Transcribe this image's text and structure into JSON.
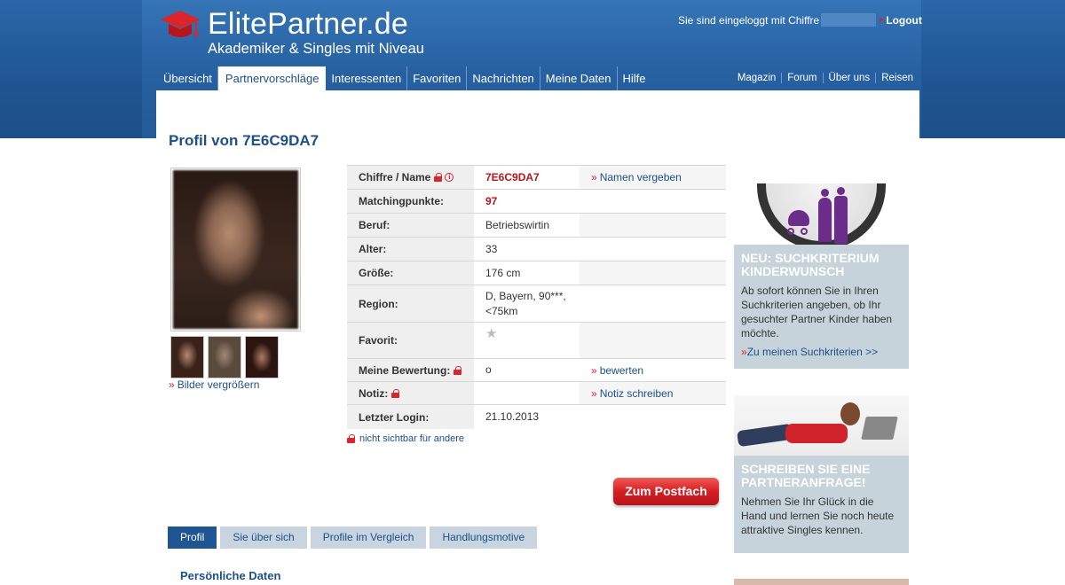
{
  "brand": {
    "logo_text": "ElitePartner.de",
    "tagline": "Akademiker & Singles mit Niveau"
  },
  "login": {
    "text": "Sie sind eingeloggt mit Chiffre",
    "logout": "Logout"
  },
  "main_nav": [
    "Übersicht",
    "Partnervorschläge",
    "Interessenten",
    "Favoriten",
    "Nachrichten",
    "Meine Daten",
    "Hilfe"
  ],
  "main_nav_active": "Partnervorschläge",
  "meta_nav": [
    "Magazin",
    "Forum",
    "Über uns",
    "Reisen"
  ],
  "profile": {
    "title": "Profil von 7E6C9DA7",
    "enlarge_link": "Bilder vergrößern",
    "rows": [
      {
        "label": "Chiffre / Name",
        "value": "7E6C9DA7",
        "action": "Namen vergeben"
      },
      {
        "label": "Matchingpunkte:",
        "value": "97",
        "action": ""
      },
      {
        "label": "Beruf:",
        "value": "Betriebswirtin",
        "action": ""
      },
      {
        "label": "Alter:",
        "value": "33",
        "action": ""
      },
      {
        "label": "Größe:",
        "value": "176 cm",
        "action": ""
      },
      {
        "label": "Region:",
        "value": "D, Bayern, 90***, <75km",
        "action": ""
      },
      {
        "label": "Favorit:",
        "value": "★",
        "action": ""
      },
      {
        "label": "Meine Bewertung:",
        "value": "o",
        "action": "bewerten"
      },
      {
        "label": "Notiz:",
        "value": "",
        "action": "Notiz schreiben"
      },
      {
        "label": "Letzter Login:",
        "value": "21.10.2013",
        "action": ""
      }
    ],
    "legend_note": "nicht sichtbar für andere",
    "postfach_button": "Zum Postfach"
  },
  "tabs": [
    "Profil",
    "Sie über sich",
    "Profile im Vergleich",
    "Handlungsmotive"
  ],
  "active_tab": "Profil",
  "section_title": "Persönliche Daten",
  "promos": [
    {
      "headline": "NEU: SUCHKRITERIUM KINDERWUNSCH",
      "text": "Ab sofort können Sie in Ihren Suchkriterien angeben, ob Ihr gesuchter Partner Kinder haben möchte.",
      "link": "Zu meinen Suchkriterien >>"
    },
    {
      "headline": "SCHREIBEN SIE EINE PARTNERANFRAGE!",
      "text": "Nehmen Sie Ihr Glück in die Hand und lernen Sie noch heute attraktive Singles kennen."
    }
  ],
  "colors": {
    "brand_blue": "#1f5592",
    "accent_red": "#d9252b",
    "promo_bg": "#c6d3db"
  }
}
